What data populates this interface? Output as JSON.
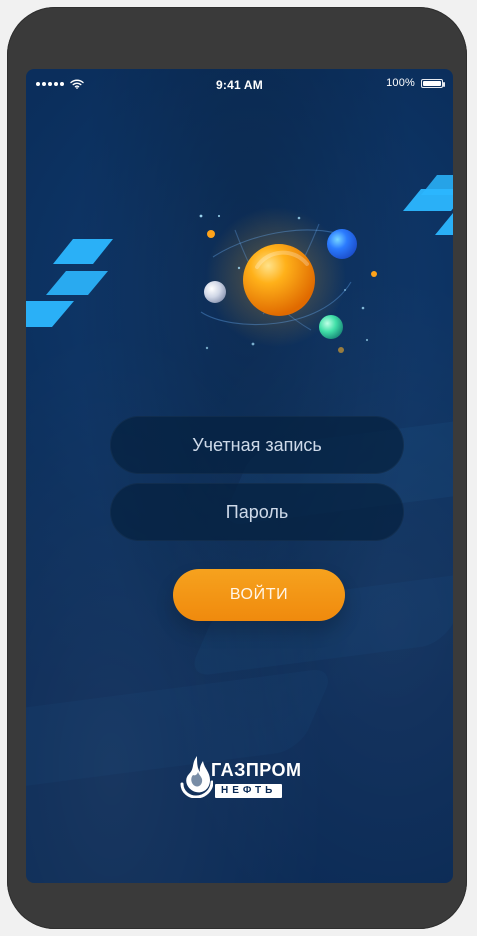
{
  "status_bar": {
    "time": "9:41 AM",
    "battery_percent": "100%",
    "signal_bars": 5,
    "battery_level": 1.0
  },
  "login": {
    "account_placeholder": "Учетная запись",
    "password_placeholder": "Пароль",
    "button_label": "ВОЙТИ"
  },
  "brand": {
    "name": "ГАЗПРОМ",
    "subtitle": "НЕФТЬ"
  },
  "colors": {
    "screen_bg": "#0B2F5D",
    "accent_orange": "#F08A0D",
    "accent_cyan": "#2CB7FF"
  }
}
